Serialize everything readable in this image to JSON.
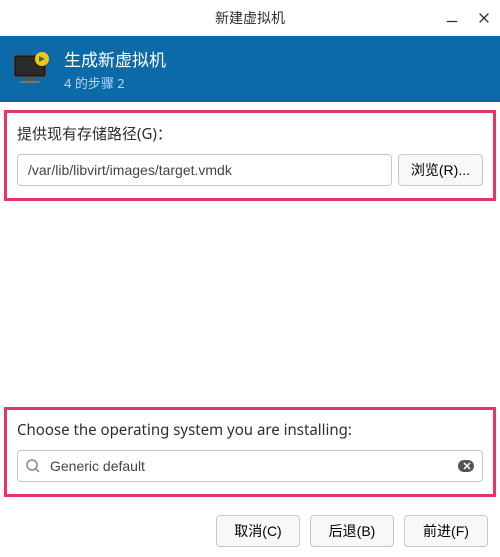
{
  "titlebar": {
    "title": "新建虚拟机"
  },
  "header": {
    "title": "生成新虚拟机",
    "subtitle": "4 的步骤 2"
  },
  "storage": {
    "label": "提供现有存储路径(G)：",
    "path": "/var/lib/libvirt/images/target.vmdk",
    "browse_label": "浏览(R)..."
  },
  "os": {
    "label": "Choose the operating system you are installing:",
    "value": "Generic default"
  },
  "footer": {
    "cancel": "取消(C)",
    "back": "后退(B)",
    "forward": "前进(F)"
  }
}
